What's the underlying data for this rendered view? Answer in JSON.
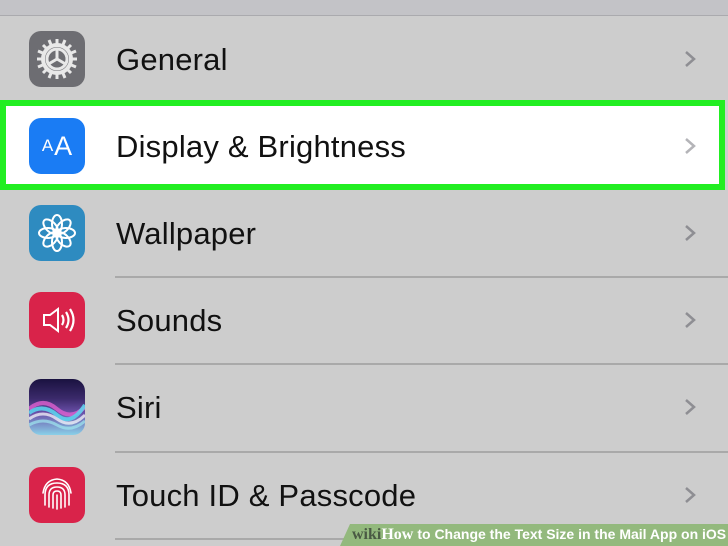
{
  "settings": {
    "items": [
      {
        "label": "General",
        "icon": "gear-icon",
        "color": "#6d6d72"
      },
      {
        "label": "Display & Brightness",
        "icon": "text-size-icon",
        "color": "#1a7cf4",
        "icon_text": "AA",
        "highlighted": true
      },
      {
        "label": "Wallpaper",
        "icon": "flower-icon",
        "color": "#2e8bc0"
      },
      {
        "label": "Sounds",
        "icon": "speaker-icon",
        "color": "#d9234a"
      },
      {
        "label": "Siri",
        "icon": "siri-icon",
        "color": "#3b2a6b"
      },
      {
        "label": "Touch ID & Passcode",
        "icon": "fingerprint-icon",
        "color": "#d9234a"
      }
    ]
  },
  "highlight_color": "#22ee22",
  "watermark": {
    "brand_wiki": "wiki",
    "brand_how": "How",
    "title": "to Change the Text Size in the Mail App on iOS"
  }
}
